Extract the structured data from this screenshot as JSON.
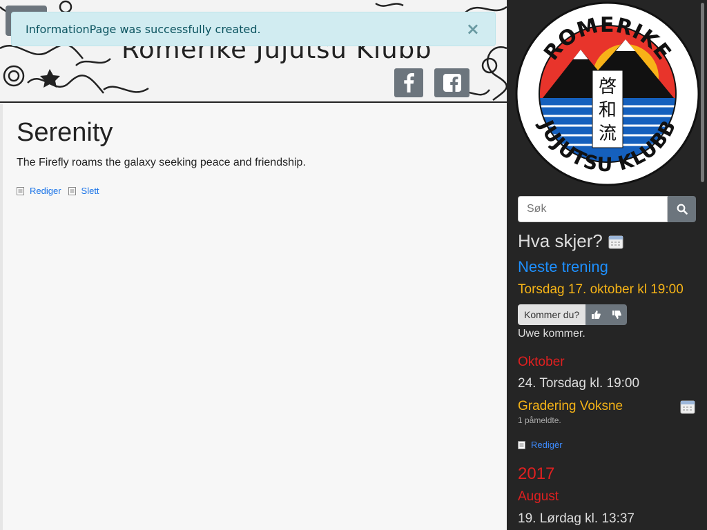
{
  "header": {
    "site_title": "Romerike Jujutsu Klubb"
  },
  "alert": {
    "message": "InformationPage was successfully created.",
    "close_label": "×"
  },
  "page": {
    "title": "Serenity",
    "body": "The Firefly roams the galaxy seeking peace and friendship.",
    "actions": {
      "edit_label": "Rediger",
      "delete_label": "Slett"
    }
  },
  "sidebar": {
    "logo": {
      "top_text": "ROMERIKE",
      "bottom_text": "JUJUTSU KLUBB",
      "kanji": [
        "啓",
        "和",
        "流"
      ]
    },
    "search": {
      "placeholder": "Søk"
    },
    "events_heading": "Hva skjer?",
    "next_training": {
      "heading": "Neste trening",
      "datetime": "Torsdag 17. oktober kl 19:00",
      "attend_label": "Kommer du?",
      "attendance_text": "Uwe kommer."
    },
    "month_groups": [
      {
        "month": "Oktober",
        "events": [
          {
            "date": "24. Torsdag kl. 19:00",
            "name": "Gradering Voksne",
            "attendees": "1 påmeldte.",
            "edit_label": "Redigèr"
          }
        ]
      }
    ],
    "year_groups": [
      {
        "year": "2017",
        "month": "August",
        "events": [
          {
            "date": "19. Lørdag kl. 13:37"
          }
        ]
      }
    ]
  },
  "colors": {
    "accent_blue": "#1e90ff",
    "event_yellow": "#f6b417",
    "month_red": "#e02020",
    "sidebar_bg": "#252525",
    "alert_bg": "#d1ecf1"
  }
}
